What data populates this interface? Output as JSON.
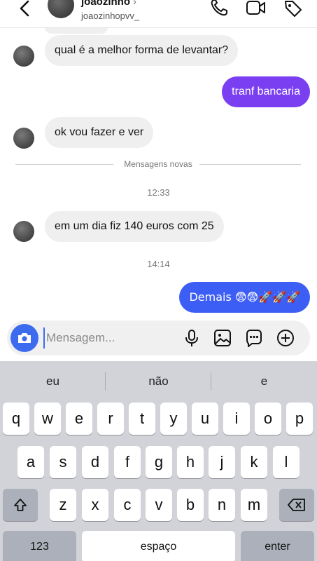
{
  "header": {
    "name": "joaozinho",
    "chevron": "›",
    "username": "joaozinhopvv_",
    "icons": [
      "back-arrow-icon",
      "phone-icon",
      "video-camera-icon",
      "tag-icon"
    ]
  },
  "messages": [
    {
      "type": "incoming",
      "text": "qual é a melhor forma de levantar?"
    },
    {
      "type": "outgoing",
      "text": "tranf bancaria",
      "color": "#7b3ff2"
    },
    {
      "type": "incoming",
      "text": "ok vou fazer e ver"
    },
    {
      "type": "divider",
      "text": "Mensagens novas"
    },
    {
      "type": "time",
      "text": "12:33"
    },
    {
      "type": "incoming",
      "text": "em um dia fiz 140 euros com 25"
    },
    {
      "type": "time",
      "text": "14:14"
    },
    {
      "type": "outgoing",
      "text": "Demais 😨😨🚀🚀🚀",
      "color": "#3d5ef5"
    }
  ],
  "composer": {
    "placeholder": "Mensagem...",
    "value": "",
    "icons": [
      "camera-icon",
      "microphone-icon",
      "gallery-icon",
      "sticker-icon",
      "plus-icon"
    ],
    "accent": "#3d6bf0"
  },
  "keyboard": {
    "suggestions": [
      "eu",
      "não",
      "e"
    ],
    "row1": [
      "q",
      "w",
      "e",
      "r",
      "t",
      "y",
      "u",
      "i",
      "o",
      "p"
    ],
    "row2": [
      "a",
      "s",
      "d",
      "f",
      "g",
      "h",
      "j",
      "k",
      "l"
    ],
    "row3": [
      "z",
      "x",
      "c",
      "v",
      "b",
      "n",
      "m"
    ],
    "numbers_label": "123",
    "space_label": "espaço",
    "enter_label": "enter"
  }
}
